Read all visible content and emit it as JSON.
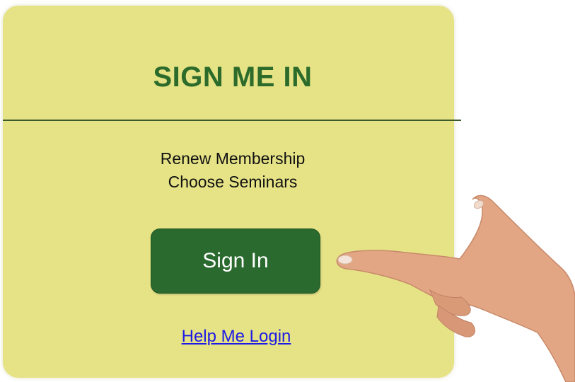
{
  "panel": {
    "title": "SIGN ME IN",
    "features": [
      "Renew Membership",
      "Choose Seminars"
    ],
    "signin_label": "Sign In",
    "help_label": "Help Me Login"
  },
  "colors": {
    "panel_bg": "#e6e387",
    "title": "#2d6b2b",
    "button_bg": "#2a6a2e",
    "link": "#1d1ae6"
  },
  "decor": {
    "pointer": "pointing-hand-icon"
  }
}
